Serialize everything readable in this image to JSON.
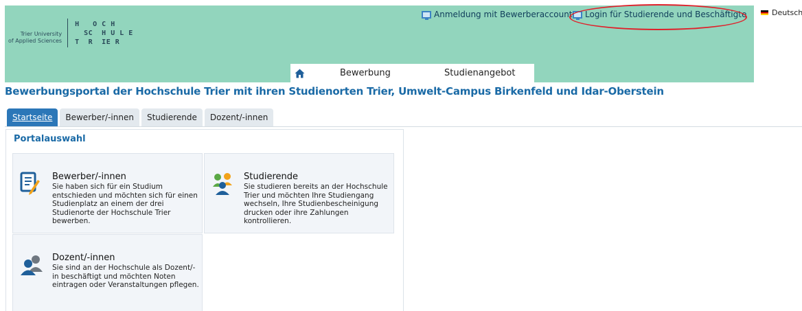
{
  "header": {
    "logo": {
      "left_line1": "Trier University",
      "left_line2": "of Applied Sciences",
      "right_text": "H   O C H\n  SC  H U L E\nT  R  IE R"
    },
    "links": {
      "apply_account": "Anmeldung mit Bewerberaccount",
      "login_staff": "Login für Studierende und Beschäftigte"
    },
    "language": "Deutsch",
    "nav": {
      "home_icon": "home-icon",
      "items": [
        "Bewerbung",
        "Studienangebot"
      ]
    }
  },
  "page_title": "Bewerbungsportal der Hochschule Trier mit ihren Studienorten Trier, Umwelt-Campus Birkenfeld und Idar-Oberstein",
  "tabs": [
    {
      "label": "Startseite",
      "active": true
    },
    {
      "label": "Bewerber/-innen",
      "active": false
    },
    {
      "label": "Studierende",
      "active": false
    },
    {
      "label": "Dozent/-innen",
      "active": false
    }
  ],
  "portal": {
    "title": "Portalauswahl",
    "cards": [
      {
        "icon": "application-form-icon",
        "heading": "Bewerber/-innen",
        "text": "Sie haben sich für ein Studium entschieden und möchten sich für einen Studienplatz an einem der drei Studienorte der Hochschule Trier bewerben."
      },
      {
        "icon": "students-group-icon",
        "heading": "Studierende",
        "text": "Sie studieren bereits an der Hochschule Trier und möchten Ihre Studiengang wechseln, Ihre Studienbescheinigung drucken oder ihre Zahlungen kontrollieren."
      },
      {
        "icon": "lecturers-icon",
        "heading": "Dozent/-innen",
        "text": "Sie sind an der Hochschule als Dozent/-in beschäftigt und möchten Noten eintragen oder Veranstaltungen pflegen."
      }
    ]
  },
  "colors": {
    "header_bg": "#92d5bd",
    "accent_blue": "#1a6aa6",
    "tab_active": "#2c77b8",
    "highlight_red": "#e0202a"
  }
}
